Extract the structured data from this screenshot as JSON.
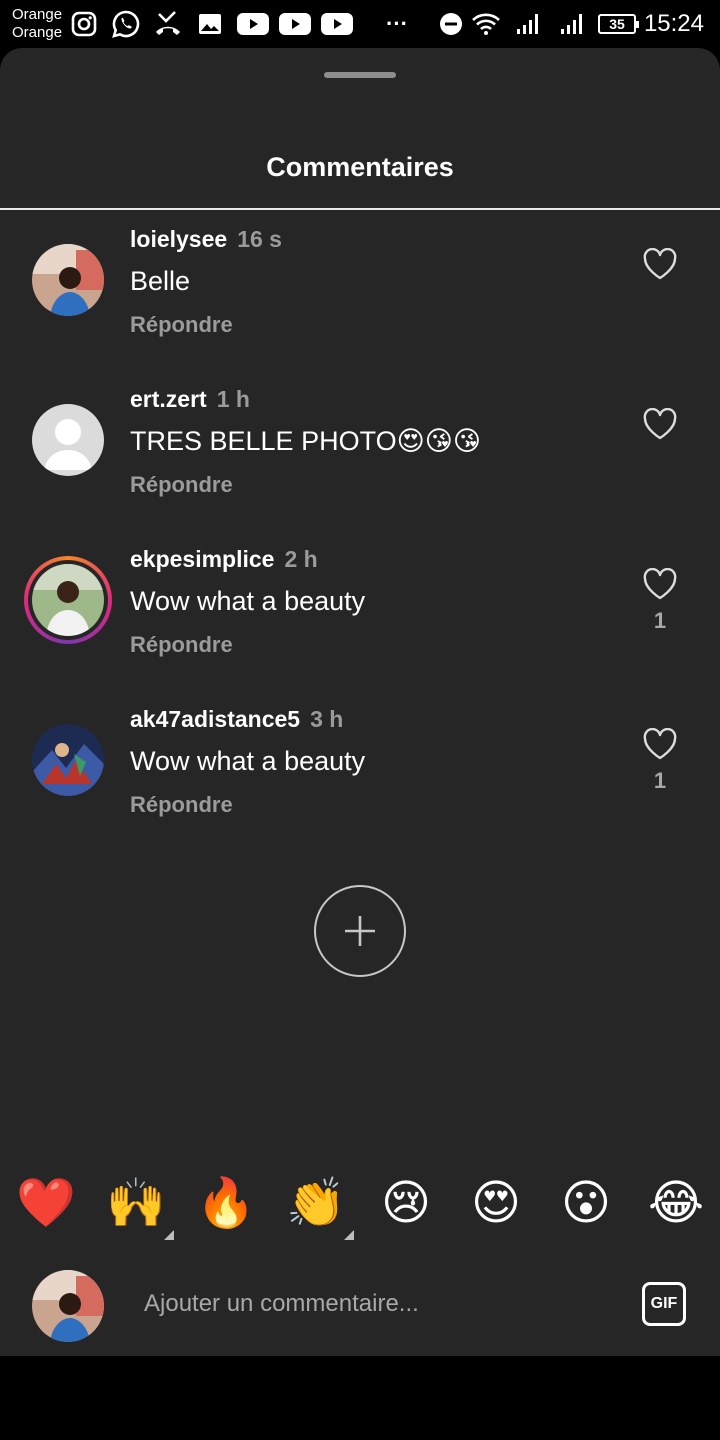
{
  "status_bar": {
    "carrier_line1": "Orange",
    "carrier_line2": "Orange",
    "notification_icons": [
      "instagram-icon",
      "whatsapp-icon",
      "missed-call-icon",
      "image-icon",
      "youtube-icon",
      "youtube-icon",
      "youtube-icon"
    ],
    "overflow": "···",
    "battery": "35",
    "time": "15:24"
  },
  "sheet": {
    "title": "Commentaires"
  },
  "comments": [
    {
      "username": "loielysee",
      "time": "16 s",
      "text": "Belle",
      "reply_label": "Répondre",
      "likes": "",
      "avatar": "photo-outdoor"
    },
    {
      "username": "ert.zert",
      "time": "1 h",
      "text": "TRES BELLE PHOTO😍😘😘",
      "reply_label": "Répondre",
      "likes": "",
      "avatar": "default-silhouette"
    },
    {
      "username": "ekpesimplice",
      "time": "2 h",
      "text": "Wow what a beauty",
      "reply_label": "Répondre",
      "likes": "1",
      "avatar": "photo-story-ring"
    },
    {
      "username": "ak47adistance5",
      "time": "3 h",
      "text": "Wow what a beauty",
      "reply_label": "Répondre",
      "likes": "1",
      "avatar": "anime-art"
    }
  ],
  "emoji_bar": [
    {
      "char": "❤️",
      "has_variants": false
    },
    {
      "char": "🙌",
      "has_variants": true
    },
    {
      "char": "🔥",
      "has_variants": false
    },
    {
      "char": "👏",
      "has_variants": true
    },
    {
      "char": "😢",
      "has_variants": false
    },
    {
      "char": "😍",
      "has_variants": false
    },
    {
      "char": "😮",
      "has_variants": false
    },
    {
      "char": "😂",
      "has_variants": false
    }
  ],
  "composer": {
    "placeholder": "Ajouter un commentaire...",
    "gif_label": "GIF"
  },
  "colors": {
    "background": "#262626",
    "muted_text": "#9b9b9b",
    "story_ring": "#dd2a7b"
  }
}
